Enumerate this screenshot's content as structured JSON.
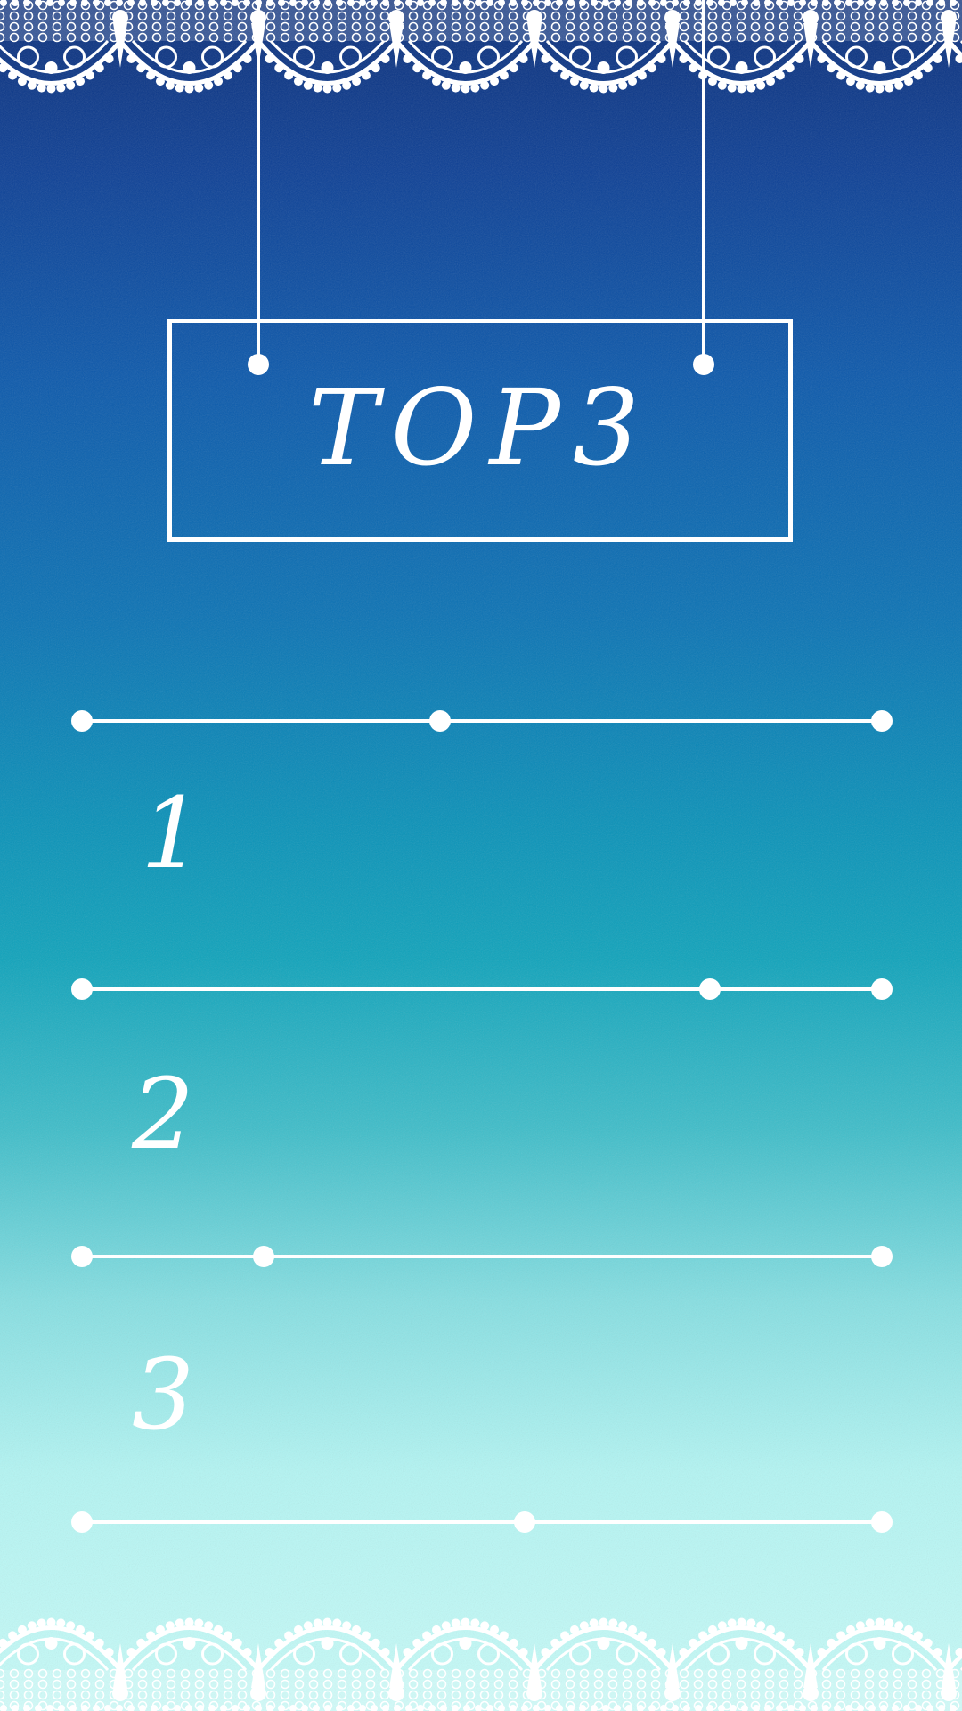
{
  "title": "TOP3",
  "ranks": [
    {
      "number": "1"
    },
    {
      "number": "2"
    },
    {
      "number": "3"
    }
  ],
  "colors": {
    "gradient_top": "#0a2e7a",
    "gradient_mid": "#0991b8",
    "gradient_bottom": "#c7fbf8",
    "ornament": "#ffffff"
  },
  "decorations": {
    "top_border": "lace-border",
    "bottom_border": "lace-border"
  }
}
